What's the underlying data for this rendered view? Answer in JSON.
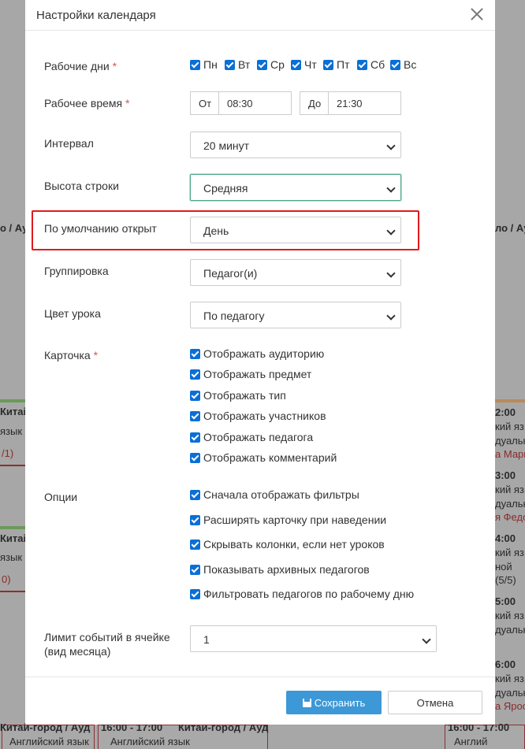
{
  "modal": {
    "title": "Настройки календаря",
    "required_mark": "*"
  },
  "work_days": {
    "label": "Рабочие дни",
    "days": [
      "Пн",
      "Вт",
      "Ср",
      "Чт",
      "Пт",
      "Сб",
      "Вс"
    ]
  },
  "work_time": {
    "label": "Рабочее время",
    "from_prefix": "От",
    "from_value": "08:30",
    "to_prefix": "До",
    "to_value": "21:30"
  },
  "interval": {
    "label": "Интервал",
    "value": "20 минут"
  },
  "row_height": {
    "label": "Высота строки",
    "value": "Средняя"
  },
  "default_view": {
    "label": "По умолчанию открыт",
    "value": "День"
  },
  "grouping": {
    "label": "Группировка",
    "value": "Педагог(и)"
  },
  "lesson_color": {
    "label": "Цвет урока",
    "value": "По педагогу"
  },
  "card": {
    "label": "Карточка",
    "options": [
      "Отображать аудиторию",
      "Отображать предмет",
      "Отображать тип",
      "Отображать участников",
      "Отображать педагога",
      "Отображать комментарий"
    ]
  },
  "options": {
    "label": "Опции",
    "items": [
      "Сначала отображать фильтры",
      "Расширять карточку при наведении",
      "Скрывать колонки, если нет уроков",
      "Показывать архивных педагогов",
      "Фильтровать педагогов по рабочему дню"
    ]
  },
  "event_limit": {
    "label_line1": "Лимит событий в ячейке",
    "label_line2": "(вид месяца)",
    "value": "1"
  },
  "footer": {
    "save_label": "Сохранить",
    "cancel_label": "Отмена"
  },
  "background": {
    "left": [
      "о / Ау",
      "Китаі",
      "язык",
      "/1)",
      "Китаі",
      "язык",
      "0)"
    ],
    "right": [
      "ло / Ауд",
      "2:00",
      "кий яз",
      "дуальн",
      "а Марг",
      "3:00",
      "кий яз",
      "дуальн",
      "я Федо",
      "4:00",
      "кий яз",
      "ной",
      "(5/5)",
      "5:00",
      "кий яз",
      "дуальн",
      "6:00",
      "кий яз",
      "дуальн",
      "а Ярос"
    ],
    "bottom": [
      "Китай-город / Ауд",
      "16:00 - 17:00",
      "Китай-город / Ауд",
      "Английский язык",
      "Английский язык",
      "16:00 - 17:00",
      "Англий"
    ]
  },
  "colors": {
    "accent": "#3c98d6",
    "checkbox": "#0a6fd6",
    "highlight": "#e0191e",
    "required": "#d9534f"
  }
}
